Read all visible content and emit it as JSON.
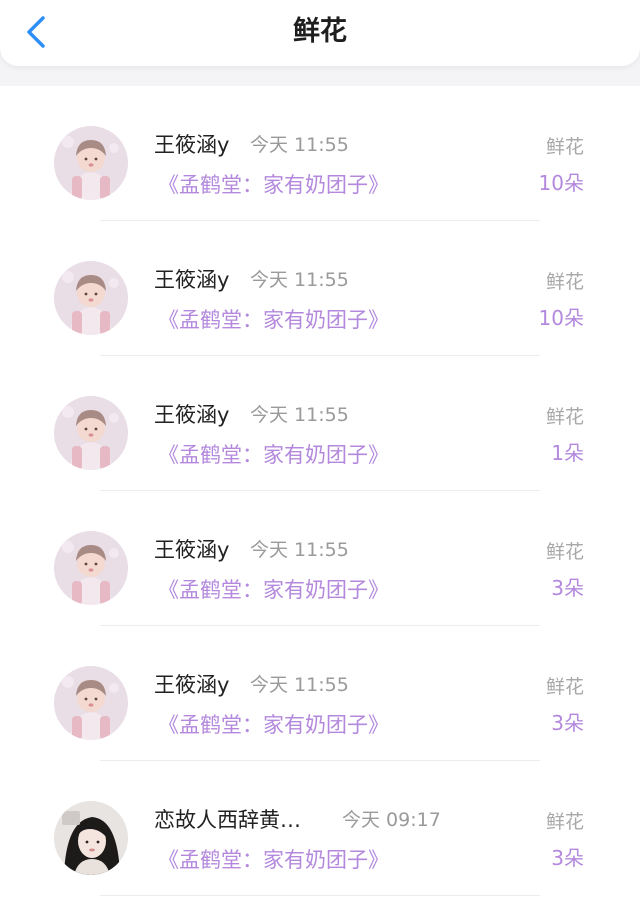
{
  "header": {
    "title": "鲜花",
    "back_icon": "chevron-left-icon",
    "accent_color": "#2f8ff5"
  },
  "colors": {
    "book_title": "#b388dd",
    "count": "#b388dd",
    "muted": "#9a9a9a"
  },
  "items": [
    {
      "user": "王筱涵y",
      "time": "今天 11:55",
      "book": "《孟鹤堂：家有奶团子》",
      "gift_type": "鲜花",
      "count": "10朵",
      "avatar": "avatar-child-pink"
    },
    {
      "user": "王筱涵y",
      "time": "今天 11:55",
      "book": "《孟鹤堂：家有奶团子》",
      "gift_type": "鲜花",
      "count": "10朵",
      "avatar": "avatar-child-pink"
    },
    {
      "user": "王筱涵y",
      "time": "今天 11:55",
      "book": "《孟鹤堂：家有奶团子》",
      "gift_type": "鲜花",
      "count": "1朵",
      "avatar": "avatar-child-pink"
    },
    {
      "user": "王筱涵y",
      "time": "今天 11:55",
      "book": "《孟鹤堂：家有奶团子》",
      "gift_type": "鲜花",
      "count": "3朵",
      "avatar": "avatar-child-pink"
    },
    {
      "user": "王筱涵y",
      "time": "今天 11:55",
      "book": "《孟鹤堂：家有奶团子》",
      "gift_type": "鲜花",
      "count": "3朵",
      "avatar": "avatar-child-pink"
    },
    {
      "user": "恋故人西辞黄…",
      "time": "今天 09:17",
      "book": "《孟鹤堂：家有奶团子》",
      "gift_type": "鲜花",
      "count": "3朵",
      "avatar": "avatar-girl-photo"
    }
  ]
}
